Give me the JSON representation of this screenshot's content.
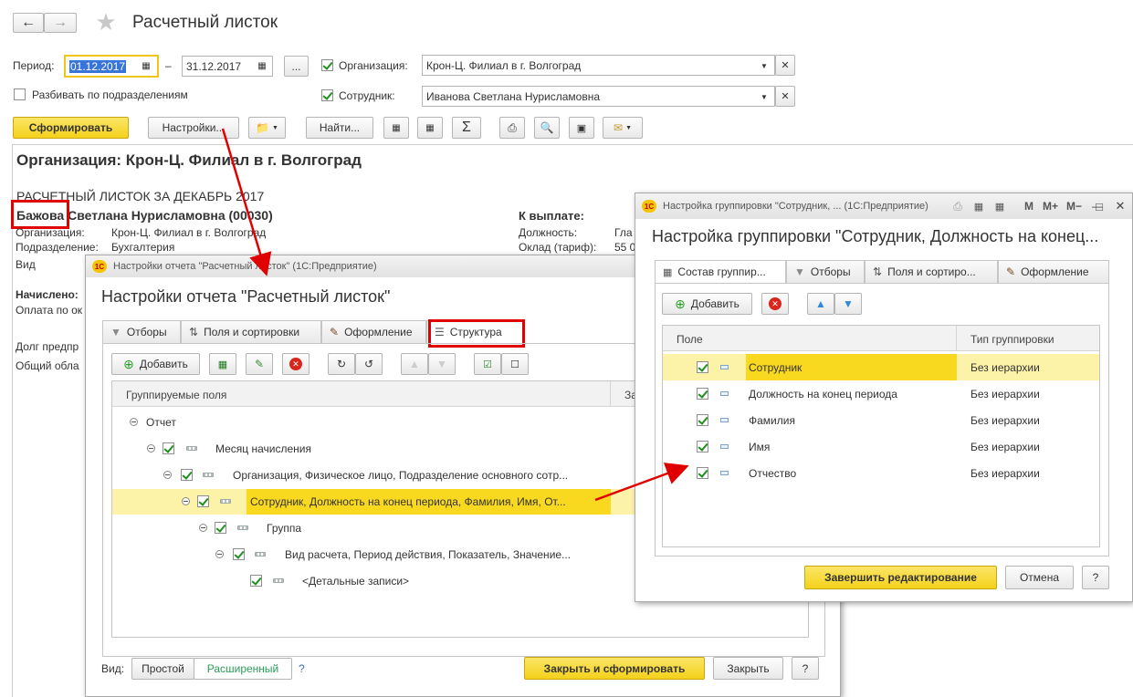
{
  "main": {
    "title": "Расчетный листок",
    "period_label": "Период:",
    "date_from": "01.12.2017",
    "date_sep": "–",
    "date_to": "31.12.2017",
    "dots_btn": "...",
    "org_label": "Организация:",
    "org_value": "Крон-Ц. Филиал в г. Волгоград",
    "split_label": "Разбивать по подразделениям",
    "emp_label": "Сотрудник:",
    "emp_value": "Иванова Светлана Нурисламовна",
    "btn_generate": "Сформировать",
    "btn_settings": "Настройки...",
    "btn_find": "Найти...",
    "sigma": "Σ"
  },
  "report": {
    "org_heading": "Организация: Крон-Ц. Филиал в г. Волгоград",
    "title": "РАСЧЕТНЫЙ ЛИСТОК ЗА ДЕКАБРЬ 2017",
    "surname": "Бажова",
    "name_rest": "Светлана Нурисламовна (00030)",
    "org_label": "Организация:",
    "org_value": "Крон-Ц. Филиал в г. Волгоград",
    "dept_label": "Подразделение:",
    "dept_value": "Бухгалтерия",
    "vid": "Вид",
    "accrued": "Начислено:",
    "pay": "Оплата по ок",
    "debt": "Долг предпр",
    "common": "Общий обла",
    "to_pay": "К выплате:",
    "position_label": "Должность:",
    "position_value": "Гла",
    "salary_label": "Оклад (тариф):",
    "salary_value": "55 0"
  },
  "dlg1": {
    "titlebar": "Настройки отчета \"Расчетный листок\"  (1С:Предприятие)",
    "heading": "Настройки отчета \"Расчетный листок\"",
    "tabs": [
      "Отборы",
      "Поля и сортировки",
      "Оформление",
      "Структура"
    ],
    "add": "Добавить",
    "col_header": "Группируемые поля",
    "col_header2": "За",
    "tree": [
      "Отчет",
      "Месяц начисления",
      "Организация, Физическое лицо, Подразделение основного сотр...",
      "Сотрудник, Должность на конец периода, Фамилия, Имя, От...",
      "Группа",
      "Вид расчета, Период действия, Показатель, Значение...",
      "<Детальные записи>"
    ],
    "view_label": "Вид:",
    "view_simple": "Простой",
    "view_ext": "Расширенный",
    "help_q": "?",
    "btn_close_gen": "Закрыть и сформировать",
    "btn_close": "Закрыть",
    "btn_help": "?"
  },
  "dlg2": {
    "titlebar": "Настройка группировки \"Сотрудник, ...  (1С:Предприятие)",
    "tb_m": "M",
    "tb_mplus": "M+",
    "tb_mminus": "M−",
    "heading": "Настройка группировки \"Сотрудник, Должность на конец...",
    "tabs": [
      "Состав группир...",
      "Отборы",
      "Поля и сортиро...",
      "Оформление"
    ],
    "add": "Добавить",
    "col_field": "Поле",
    "col_type": "Тип группировки",
    "rows": [
      {
        "field": "Сотрудник",
        "type": "Без иерархии"
      },
      {
        "field": "Должность на конец периода",
        "type": "Без иерархии"
      },
      {
        "field": "Фамилия",
        "type": "Без иерархии"
      },
      {
        "field": "Имя",
        "type": "Без иерархии"
      },
      {
        "field": "Отчество",
        "type": "Без иерархии"
      }
    ],
    "btn_finish": "Завершить редактирование",
    "btn_cancel": "Отмена",
    "btn_help": "?"
  },
  "colors": {
    "accent_yellow": "#f4d11b",
    "highlight_row": "#fdf3a8",
    "selected_cell": "#f9d91f",
    "red_annotation": "#e00000"
  }
}
